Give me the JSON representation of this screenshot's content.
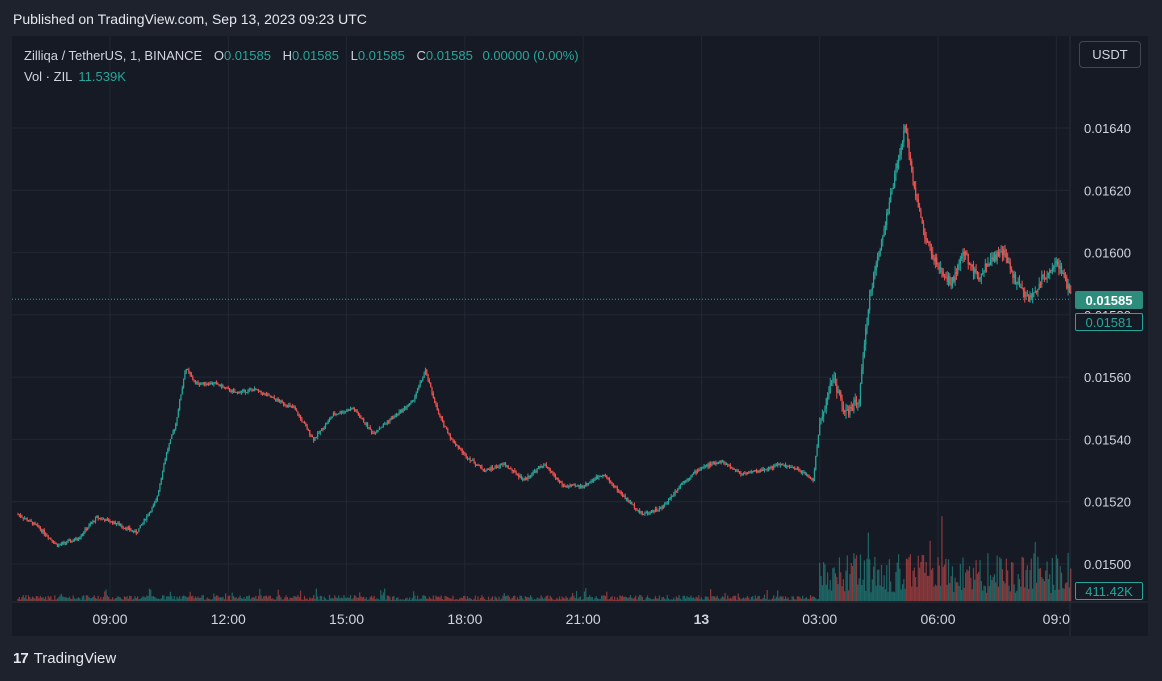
{
  "header": {
    "published": "Published on TradingView.com, Sep 13, 2023 09:23 UTC"
  },
  "legend": {
    "symbol": "Zilliqa / TetherUS, 1, BINANCE",
    "o_label": "O",
    "o": "0.01585",
    "h_label": "H",
    "h": "0.01585",
    "l_label": "L",
    "l": "0.01585",
    "c_label": "C",
    "c": "0.01585",
    "change": "0.00000 (0.00%)",
    "vol_label": "Vol · ZIL",
    "vol": "11.539K"
  },
  "unit_button": "USDT",
  "price_tags": {
    "last": "0.01585",
    "close": "0.01581",
    "volume": "411.42K"
  },
  "brand": {
    "logo": "17",
    "name": "TradingView"
  },
  "colors": {
    "up": "#26a69a",
    "down": "#ef5350",
    "background": "#161a25",
    "grid": "#232734"
  },
  "chart_data": {
    "type": "candlestick",
    "title": "Zilliqa / TetherUS, 1, BINANCE",
    "y_ticks": [
      "0.01640",
      "0.01620",
      "0.01600",
      "0.01580",
      "0.01560",
      "0.01540",
      "0.01520",
      "0.01500"
    ],
    "x_ticks": [
      "09:00",
      "12:00",
      "15:00",
      "18:00",
      "21:00",
      "13",
      "03:00",
      "06:00",
      "09:0"
    ],
    "ylim": [
      0.01488,
      0.01656
    ],
    "last_price": 0.01585,
    "series_close": [
      [
        "06:40",
        0.01516
      ],
      [
        "07:10",
        0.01512
      ],
      [
        "07:40",
        0.01506
      ],
      [
        "08:10",
        0.01508
      ],
      [
        "08:40",
        0.01515
      ],
      [
        "09:10",
        0.01513
      ],
      [
        "09:40",
        0.0151
      ],
      [
        "10:10",
        0.0152
      ],
      [
        "10:25",
        0.01535
      ],
      [
        "10:40",
        0.01545
      ],
      [
        "10:55",
        0.01563
      ],
      [
        "11:10",
        0.01558
      ],
      [
        "11:40",
        0.01558
      ],
      [
        "12:10",
        0.01555
      ],
      [
        "12:40",
        0.01556
      ],
      [
        "13:10",
        0.01553
      ],
      [
        "13:40",
        0.0155
      ],
      [
        "14:10",
        0.0154
      ],
      [
        "14:40",
        0.01548
      ],
      [
        "15:10",
        0.0155
      ],
      [
        "15:40",
        0.01542
      ],
      [
        "16:10",
        0.01547
      ],
      [
        "16:40",
        0.01552
      ],
      [
        "17:00",
        0.01562
      ],
      [
        "17:20",
        0.01548
      ],
      [
        "17:40",
        0.0154
      ],
      [
        "18:00",
        0.01535
      ],
      [
        "18:30",
        0.0153
      ],
      [
        "19:00",
        0.01532
      ],
      [
        "19:30",
        0.01527
      ],
      [
        "20:00",
        0.01532
      ],
      [
        "20:30",
        0.01525
      ],
      [
        "21:00",
        0.01525
      ],
      [
        "21:30",
        0.01529
      ],
      [
        "22:00",
        0.01522
      ],
      [
        "22:30",
        0.01516
      ],
      [
        "23:00",
        0.01518
      ],
      [
        "23:30",
        0.01526
      ],
      [
        "00:00",
        0.01531
      ],
      [
        "00:30",
        0.01533
      ],
      [
        "01:00",
        0.01529
      ],
      [
        "01:30",
        0.0153
      ],
      [
        "02:00",
        0.01532
      ],
      [
        "02:30",
        0.0153
      ],
      [
        "02:50",
        0.01527
      ],
      [
        "03:00",
        0.01545
      ],
      [
        "03:20",
        0.0156
      ],
      [
        "03:40",
        0.01548
      ],
      [
        "04:00",
        0.01553
      ],
      [
        "04:15",
        0.01585
      ],
      [
        "04:35",
        0.01605
      ],
      [
        "04:55",
        0.01625
      ],
      [
        "05:10",
        0.0164
      ],
      [
        "05:25",
        0.0162
      ],
      [
        "05:40",
        0.01605
      ],
      [
        "06:00",
        0.01595
      ],
      [
        "06:20",
        0.0159
      ],
      [
        "06:40",
        0.016
      ],
      [
        "07:00",
        0.01592
      ],
      [
        "07:20",
        0.01598
      ],
      [
        "07:40",
        0.016
      ],
      [
        "08:00",
        0.0159
      ],
      [
        "08:20",
        0.01585
      ],
      [
        "08:40",
        0.01592
      ],
      [
        "09:00",
        0.01597
      ],
      [
        "09:20",
        0.01588
      ],
      [
        "09:23",
        0.01585
      ]
    ]
  }
}
